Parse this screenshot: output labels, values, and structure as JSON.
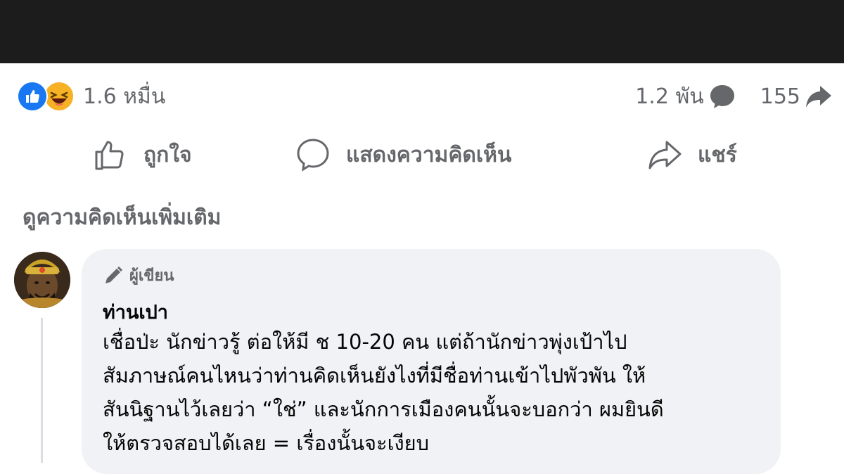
{
  "reactions": {
    "count": "1.6 หมื่น",
    "types": [
      "like-icon",
      "haha-icon"
    ],
    "like_color": "#1877f2",
    "haha_color": "#f7b125"
  },
  "stats": {
    "comments_count": "1.2 พัน",
    "comments_icon": "comment-bubble-icon",
    "shares_count": "155",
    "shares_icon": "share-arrow-icon"
  },
  "actions": {
    "like_label": "ถูกใจ",
    "comment_label": "แสดงความคิดเห็น",
    "share_label": "แชร์"
  },
  "more_comments_label": "ดูความคิดเห็นเพิ่มเติม",
  "comment": {
    "badge": "ผู้เขียน",
    "author": "ท่านเปา",
    "lines": [
      "เชื่อป่ะ นักข่าวรู้ ต่อให้มี ช 10-20 คน แต่ถ้านักข่าวพุ่งเป้าไป",
      "สัมภาษณ์คนไหนว่าท่านคิดเห็นยังไงที่มีชื่อท่านเข้าไปพัวพัน ให้",
      "สันนิฐานไว้เลยว่า “ใช่” และนักการเมืองคนนั้นจะบอกว่า ผมยินดี",
      "ให้ตรวจสอบได้เลย = เรื่องนั้นจะเงียบ"
    ]
  },
  "colors": {
    "top_bar": "#1c1c1c",
    "secondary_text": "#65676b",
    "bubble_bg": "#f0f2f5"
  }
}
